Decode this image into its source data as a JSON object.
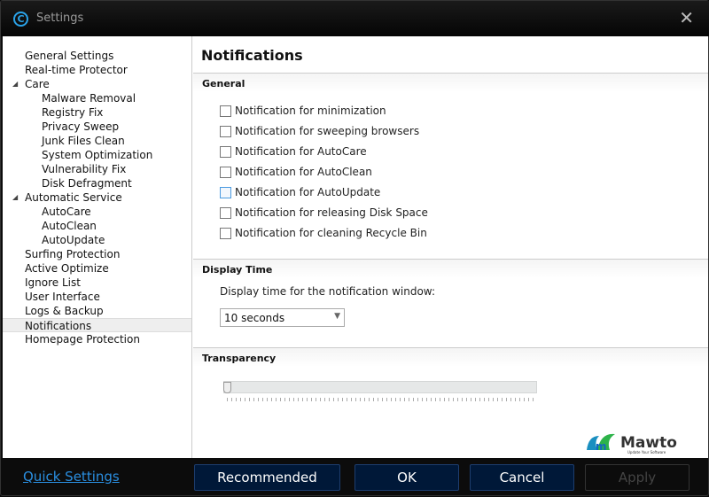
{
  "window": {
    "title": "Settings",
    "close": "✕"
  },
  "sidebar": {
    "items": [
      {
        "label": "General Settings",
        "level": 0
      },
      {
        "label": "Real-time Protector",
        "level": 0
      },
      {
        "label": "Care",
        "level": 0,
        "expanded": true
      },
      {
        "label": "Malware Removal",
        "level": 1
      },
      {
        "label": "Registry Fix",
        "level": 1
      },
      {
        "label": "Privacy Sweep",
        "level": 1
      },
      {
        "label": "Junk Files Clean",
        "level": 1
      },
      {
        "label": "System Optimization",
        "level": 1
      },
      {
        "label": "Vulnerability Fix",
        "level": 1
      },
      {
        "label": "Disk Defragment",
        "level": 1
      },
      {
        "label": "Automatic Service",
        "level": 0,
        "expanded": true
      },
      {
        "label": "AutoCare",
        "level": 1
      },
      {
        "label": "AutoClean",
        "level": 1
      },
      {
        "label": "AutoUpdate",
        "level": 1
      },
      {
        "label": "Surfing Protection",
        "level": 0
      },
      {
        "label": "Active Optimize",
        "level": 0
      },
      {
        "label": "Ignore List",
        "level": 0
      },
      {
        "label": "User Interface",
        "level": 0
      },
      {
        "label": "Logs & Backup",
        "level": 0
      },
      {
        "label": "Notifications",
        "level": 0,
        "selected": true
      },
      {
        "label": "Homepage Protection",
        "level": 0
      }
    ]
  },
  "main": {
    "title": "Notifications",
    "general": {
      "title": "General",
      "options": [
        {
          "label": "Notification for minimization",
          "checked": false
        },
        {
          "label": "Notification for sweeping browsers",
          "checked": false
        },
        {
          "label": "Notification for AutoCare",
          "checked": false
        },
        {
          "label": "Notification for AutoClean",
          "checked": false
        },
        {
          "label": "Notification for AutoUpdate",
          "checked": false,
          "hover": true
        },
        {
          "label": "Notification for releasing Disk Space",
          "checked": false
        },
        {
          "label": "Notification for cleaning Recycle Bin",
          "checked": false
        }
      ]
    },
    "display_time": {
      "title": "Display Time",
      "label": "Display time for the notification window:",
      "value": "10 seconds"
    },
    "transparency": {
      "title": "Transparency",
      "value_percent": 0
    },
    "brand": {
      "name": "Mawto",
      "tagline": "Update Your Software"
    }
  },
  "footer": {
    "quick_settings": "Quick Settings",
    "recommended": "Recommended",
    "ok": "OK",
    "cancel": "Cancel",
    "apply": "Apply",
    "apply_disabled": true
  }
}
